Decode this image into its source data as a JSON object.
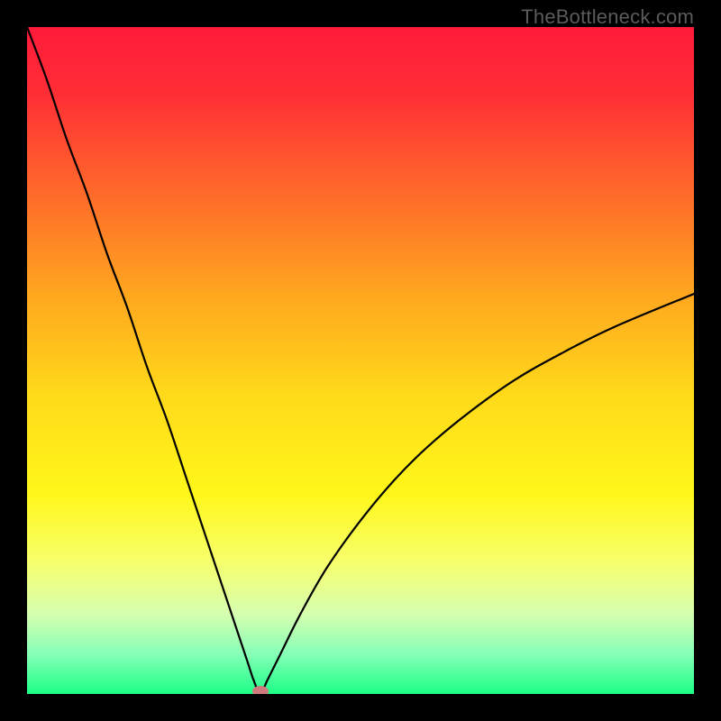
{
  "watermark": "TheBottleneck.com",
  "chart_data": {
    "type": "line",
    "title": "",
    "xlabel": "",
    "ylabel": "",
    "xlim": [
      0,
      100
    ],
    "ylim": [
      0,
      100
    ],
    "background": {
      "gradient_stops": [
        {
          "pos": 0.0,
          "color": "#ff1a3a"
        },
        {
          "pos": 0.1,
          "color": "#ff2e36"
        },
        {
          "pos": 0.25,
          "color": "#ff6a2a"
        },
        {
          "pos": 0.4,
          "color": "#ffa61f"
        },
        {
          "pos": 0.55,
          "color": "#ffd91a"
        },
        {
          "pos": 0.7,
          "color": "#fff71a"
        },
        {
          "pos": 0.8,
          "color": "#f7ff6a"
        },
        {
          "pos": 0.88,
          "color": "#d6ffb0"
        },
        {
          "pos": 0.94,
          "color": "#86ffb6"
        },
        {
          "pos": 1.0,
          "color": "#1cff87"
        }
      ]
    },
    "curve": {
      "note": "V-shaped bottleneck curve; y ≈ 100 at left edge, dips to ~0 near x ≈ 35, rises toward ~60 at right edge.",
      "vertex_x": 35,
      "x": [
        0,
        3,
        6,
        9,
        12,
        15,
        18,
        21,
        24,
        27,
        30,
        33,
        34,
        35,
        36,
        38,
        41,
        45,
        50,
        55,
        60,
        66,
        73,
        80,
        88,
        100
      ],
      "y": [
        100,
        92,
        83,
        75,
        66,
        58,
        49,
        41,
        32,
        23,
        14,
        5,
        2,
        0,
        2,
        6,
        12,
        19,
        26,
        32,
        37,
        42,
        47,
        51,
        55,
        60
      ]
    },
    "marker": {
      "x": 35,
      "y": 0,
      "color": "#cf7b7e",
      "rx": 9,
      "ry": 6
    }
  }
}
